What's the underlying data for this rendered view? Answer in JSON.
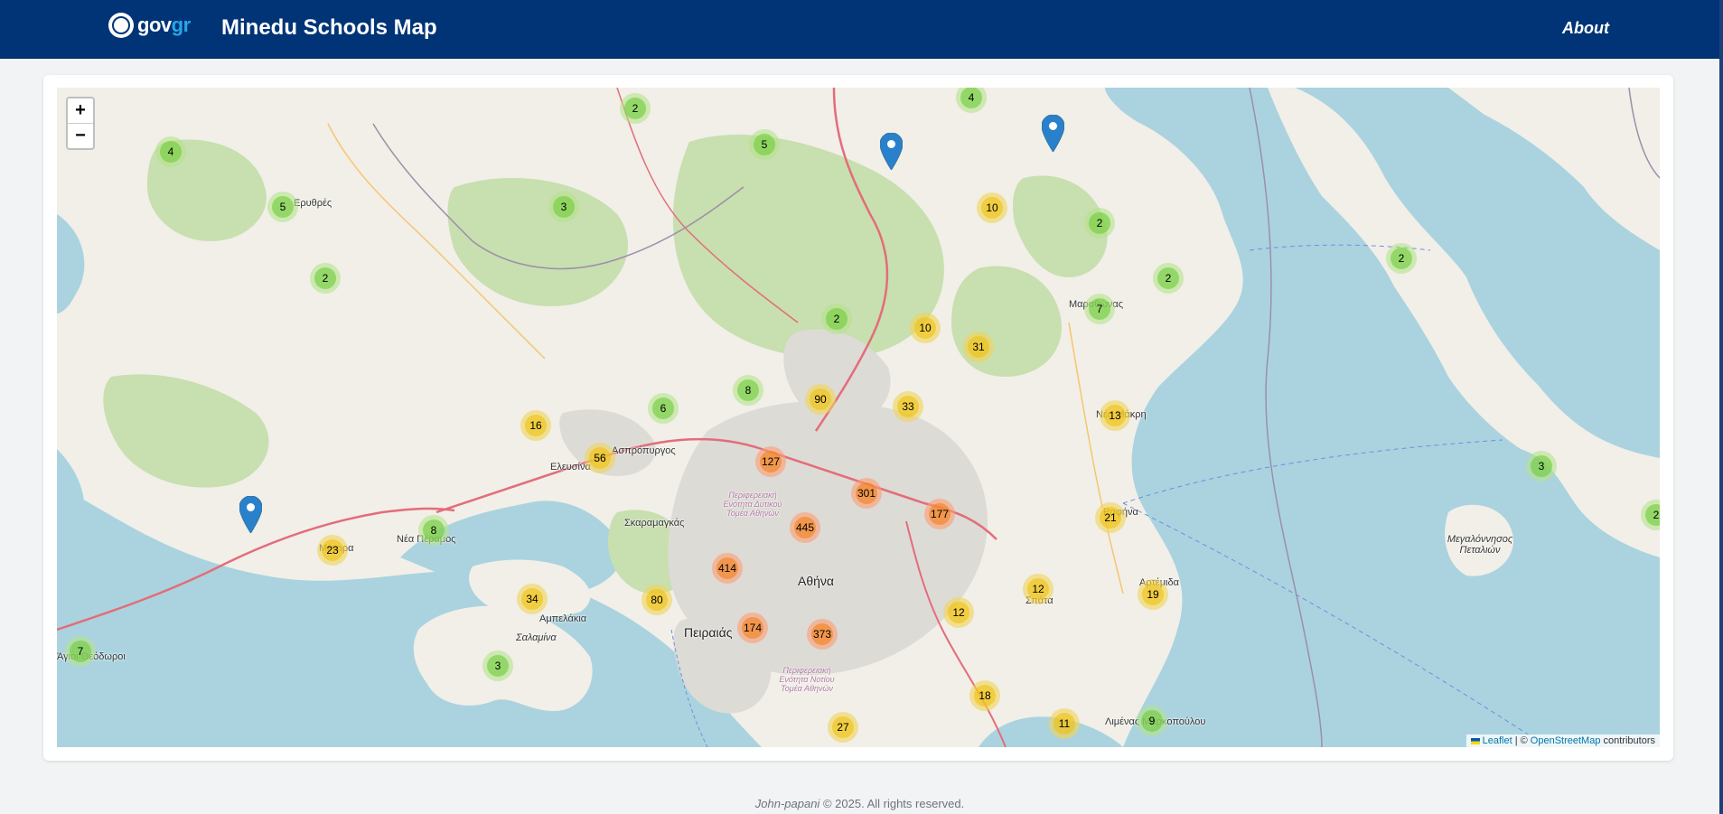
{
  "header": {
    "logo_text": "gov",
    "logo_text_accent": "gr",
    "title": "Minedu Schools Map",
    "about_link": "About"
  },
  "map": {
    "zoom_in": "+",
    "zoom_out": "−",
    "place_labels": [
      {
        "name": "Αθήνα",
        "size": "big"
      },
      {
        "name": "Πειραιάς",
        "size": "big"
      },
      {
        "name": "Σαλαμίνα",
        "size": "island"
      },
      {
        "name": "Ελευσίνα"
      },
      {
        "name": "Ασπρόπυργος"
      },
      {
        "name": "Σκαραμαγκάς"
      },
      {
        "name": "Αμπελάκια"
      },
      {
        "name": "Νέα Πέραμος"
      },
      {
        "name": "Ραφήνα"
      },
      {
        "name": "Μεγαλόννησος Πεταλιών",
        "size": "island"
      },
      {
        "name": "Μαραθώνας"
      },
      {
        "name": "Νέα Μάκρη"
      },
      {
        "name": "Αρτέμιδα"
      },
      {
        "name": "Σπάτα"
      },
      {
        "name": "Ερυθρές"
      },
      {
        "name": "Μέγαρα"
      },
      {
        "name": "Άγιοι Θεόδωροι"
      },
      {
        "name": "Λιμένας Μαρκοπούλου"
      },
      {
        "name": "Περιφερειακή Ενότητα Δυτικού Τομέα Αθηνών"
      },
      {
        "name": "Περιφερειακή Ενότητα Νοτίου Τομέα Αθηνών"
      }
    ],
    "clusters": [
      {
        "count": 4,
        "tier": "small"
      },
      {
        "count": 5,
        "tier": "small"
      },
      {
        "count": 2,
        "tier": "small"
      },
      {
        "count": 2,
        "tier": "small"
      },
      {
        "count": 3,
        "tier": "small"
      },
      {
        "count": 5,
        "tier": "small"
      },
      {
        "count": 4,
        "tier": "small"
      },
      {
        "count": 10,
        "tier": "medium"
      },
      {
        "count": 2,
        "tier": "small"
      },
      {
        "count": 2,
        "tier": "small"
      },
      {
        "count": 7,
        "tier": "small"
      },
      {
        "count": 2,
        "tier": "small"
      },
      {
        "count": 2,
        "tier": "small"
      },
      {
        "count": 10,
        "tier": "medium"
      },
      {
        "count": 31,
        "tier": "medium"
      },
      {
        "count": 8,
        "tier": "small"
      },
      {
        "count": 90,
        "tier": "medium"
      },
      {
        "count": 33,
        "tier": "medium"
      },
      {
        "count": 13,
        "tier": "medium"
      },
      {
        "count": 6,
        "tier": "small"
      },
      {
        "count": 16,
        "tier": "medium"
      },
      {
        "count": 56,
        "tier": "medium"
      },
      {
        "count": 127,
        "tier": "large"
      },
      {
        "count": 301,
        "tier": "large"
      },
      {
        "count": 177,
        "tier": "large"
      },
      {
        "count": 445,
        "tier": "large"
      },
      {
        "count": 21,
        "tier": "medium"
      },
      {
        "count": 3,
        "tier": "small"
      },
      {
        "count": 2,
        "tier": "small"
      },
      {
        "count": 8,
        "tier": "small"
      },
      {
        "count": 23,
        "tier": "medium"
      },
      {
        "count": 414,
        "tier": "large"
      },
      {
        "count": 12,
        "tier": "medium"
      },
      {
        "count": 19,
        "tier": "medium"
      },
      {
        "count": 34,
        "tier": "medium"
      },
      {
        "count": 80,
        "tier": "medium"
      },
      {
        "count": 12,
        "tier": "medium"
      },
      {
        "count": 174,
        "tier": "large"
      },
      {
        "count": 373,
        "tier": "large"
      },
      {
        "count": 3,
        "tier": "small"
      },
      {
        "count": 7,
        "tier": "small"
      },
      {
        "count": 18,
        "tier": "medium"
      },
      {
        "count": 27,
        "tier": "medium"
      },
      {
        "count": 11,
        "tier": "medium"
      },
      {
        "count": 9,
        "tier": "small"
      }
    ],
    "single_markers": 3,
    "attribution": {
      "leaflet": "Leaflet",
      "separator": "| ©",
      "osm": "OpenStreetMap",
      "suffix": "contributors"
    },
    "colors": {
      "sea": "#aad3df",
      "land": "#f1efe8",
      "forest": "#c8dfb0",
      "urban": "#dddbd6",
      "motorway": "#e36d7a",
      "marker": "#2a81cb"
    }
  },
  "footer": {
    "author": "John-papani",
    "text": "© 2025. All rights reserved."
  }
}
